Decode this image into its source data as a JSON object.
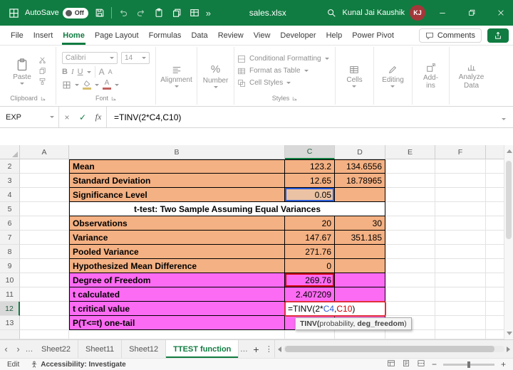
{
  "colors": {
    "titlebar_green": "#107C41",
    "accent_green": "#107C41",
    "orange_fill": "#F4B183",
    "pink_fill": "#FC6BF3",
    "ref_blue": "#2B5CD9",
    "ref_red": "#D10000",
    "edit_border_red": "#E0303B",
    "avatar_red": "#A4373A"
  },
  "titlebar": {
    "autosave_label": "AutoSave",
    "autosave_state": "Off",
    "overflow": "»",
    "filename": "sales.xlsx",
    "user_name": "Kunal Jai Kaushik",
    "user_initials": "KJ"
  },
  "ribbon_tabs": {
    "items": [
      "File",
      "Insert",
      "Home",
      "Page Layout",
      "Formulas",
      "Data",
      "Review",
      "View",
      "Developer",
      "Help",
      "Power Pivot"
    ],
    "active": "Home",
    "comments": "Comments"
  },
  "ribbon": {
    "clipboard": {
      "paste": "Paste",
      "label": "Clipboard"
    },
    "font": {
      "name": "Calibri",
      "size": "14",
      "bold": "B",
      "italic": "I",
      "underline": "U",
      "grow": "A",
      "shrink": "A",
      "color_letter": "A",
      "label": "Font"
    },
    "alignment": {
      "label": "Alignment"
    },
    "number": {
      "symbol": "%",
      "label": "Number"
    },
    "styles": {
      "conditional": "Conditional Formatting",
      "format_table": "Format as Table",
      "cell_styles": "Cell Styles",
      "label": "Styles"
    },
    "cells": {
      "label": "Cells"
    },
    "editing": {
      "label": "Editing"
    },
    "addins": {
      "label": "Add-ins"
    },
    "analyze": {
      "label": "Analyze Data"
    }
  },
  "formula_bar": {
    "name_box": "EXP",
    "cancel": "×",
    "enter": "✓",
    "fx": "fx",
    "formula": "=TINV(2*C4,C10)"
  },
  "grid": {
    "columns": [
      "A",
      "B",
      "C",
      "D",
      "E",
      "F"
    ],
    "rows": [
      {
        "num": "2",
        "label": "Mean",
        "c": "123.2",
        "d": "134.6556"
      },
      {
        "num": "3",
        "label": "Standard Deviation",
        "c": "12.65",
        "d": "18.78965"
      },
      {
        "num": "4",
        "label": "Significance Level",
        "c": "0.05",
        "d": ""
      },
      {
        "num": "5",
        "merged": "t-test: Two Sample Assuming Equal Variances"
      },
      {
        "num": "6",
        "label": "Observations",
        "c": "20",
        "d": "30"
      },
      {
        "num": "7",
        "label": "Variance",
        "c": "147.67",
        "d": "351.185"
      },
      {
        "num": "8",
        "label": "Pooled Variance",
        "c": "271.76",
        "d": ""
      },
      {
        "num": "9",
        "label": "Hypothesized Mean Difference",
        "c": "0",
        "d": ""
      },
      {
        "num": "10",
        "label": "Degree of Freedom",
        "c": "269.76",
        "d": ""
      },
      {
        "num": "11",
        "label": "t calculated",
        "c": "2.407209",
        "d": ""
      },
      {
        "num": "12",
        "label": "t critical value",
        "c": "",
        "d": ""
      },
      {
        "num": "13",
        "label": "P(T<=t) one-tail",
        "c": "",
        "d": ""
      }
    ],
    "edit": {
      "p0": "=TINV(2*",
      "ref1": "C4",
      "comma": ",",
      "ref2": "C10",
      "close": ")"
    },
    "tooltip": {
      "fn": "TINV(",
      "arg1": "probability, ",
      "arg2": "deg_freedom",
      "close": ")"
    }
  },
  "sheet_bar": {
    "ellipsis_left": "…",
    "tabs": [
      "Sheet22",
      "Sheet11",
      "Sheet12",
      "TTEST function"
    ],
    "active": "TTEST function",
    "ellipsis_right": "…",
    "add": "+",
    "kebab": "⋮"
  },
  "status_bar": {
    "mode": "Edit",
    "accessibility": "Accessibility: Investigate"
  }
}
